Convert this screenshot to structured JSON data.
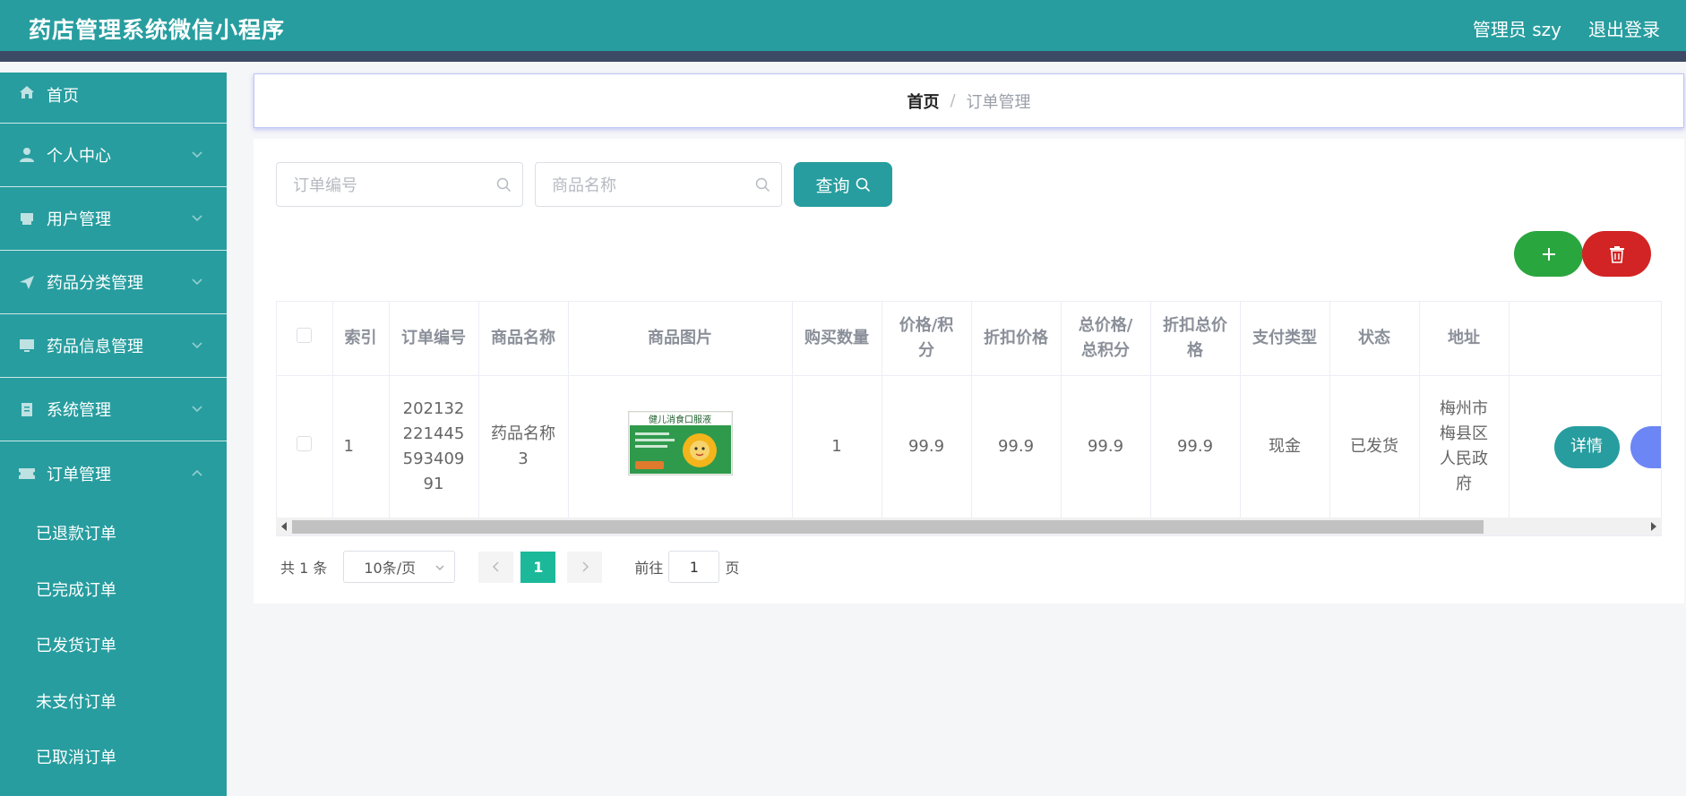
{
  "header": {
    "title": "药店管理系统微信小程序",
    "user": "管理员 szy",
    "logout": "退出登录"
  },
  "sidebar": {
    "items": [
      {
        "label": "首页",
        "icon": "home-icon"
      },
      {
        "label": "个人中心",
        "icon": "user-icon"
      },
      {
        "label": "用户管理",
        "icon": "printer-icon"
      },
      {
        "label": "药品分类管理",
        "icon": "send-icon"
      },
      {
        "label": "药品信息管理",
        "icon": "monitor-icon"
      },
      {
        "label": "系统管理",
        "icon": "clipboard-icon"
      },
      {
        "label": "订单管理",
        "icon": "tickets-icon"
      }
    ],
    "submenu": [
      "已退款订单",
      "已完成订单",
      "已发货订单",
      "未支付订单",
      "已取消订单"
    ]
  },
  "breadcrumb": {
    "home": "首页",
    "separator": "/",
    "current": "订单管理"
  },
  "search": {
    "order_no_placeholder": "订单编号",
    "product_name_placeholder": "商品名称",
    "query_label": "查询"
  },
  "table": {
    "headers": [
      "索引",
      "订单编号",
      "商品名称",
      "商品图片",
      "购买数量",
      "价格/积分",
      "折扣价格",
      "总价格/总积分",
      "折扣总价格",
      "支付类型",
      "状态",
      "地址"
    ],
    "rows": [
      {
        "index": "1",
        "order_no": "20213222144559340991",
        "product_name": "药品名称3",
        "image_text": "健儿消食口服液",
        "quantity": "1",
        "price": "99.9",
        "discount_price": "99.9",
        "total_price": "99.9",
        "discount_total": "99.9",
        "pay_type": "现金",
        "status": "已发货",
        "address": "梅州市梅县区人民政府",
        "detail_label": "详情"
      }
    ]
  },
  "pagination": {
    "total": "共 1 条",
    "page_size": "10条/页",
    "current_page": "1",
    "goto_prefix": "前往",
    "goto_value": "1",
    "goto_suffix": "页"
  },
  "colors": {
    "primary": "#279d9f",
    "header_strip": "#3c4a66",
    "add": "#2aa63f",
    "delete": "#d22424",
    "page_active": "#1bb99a"
  }
}
